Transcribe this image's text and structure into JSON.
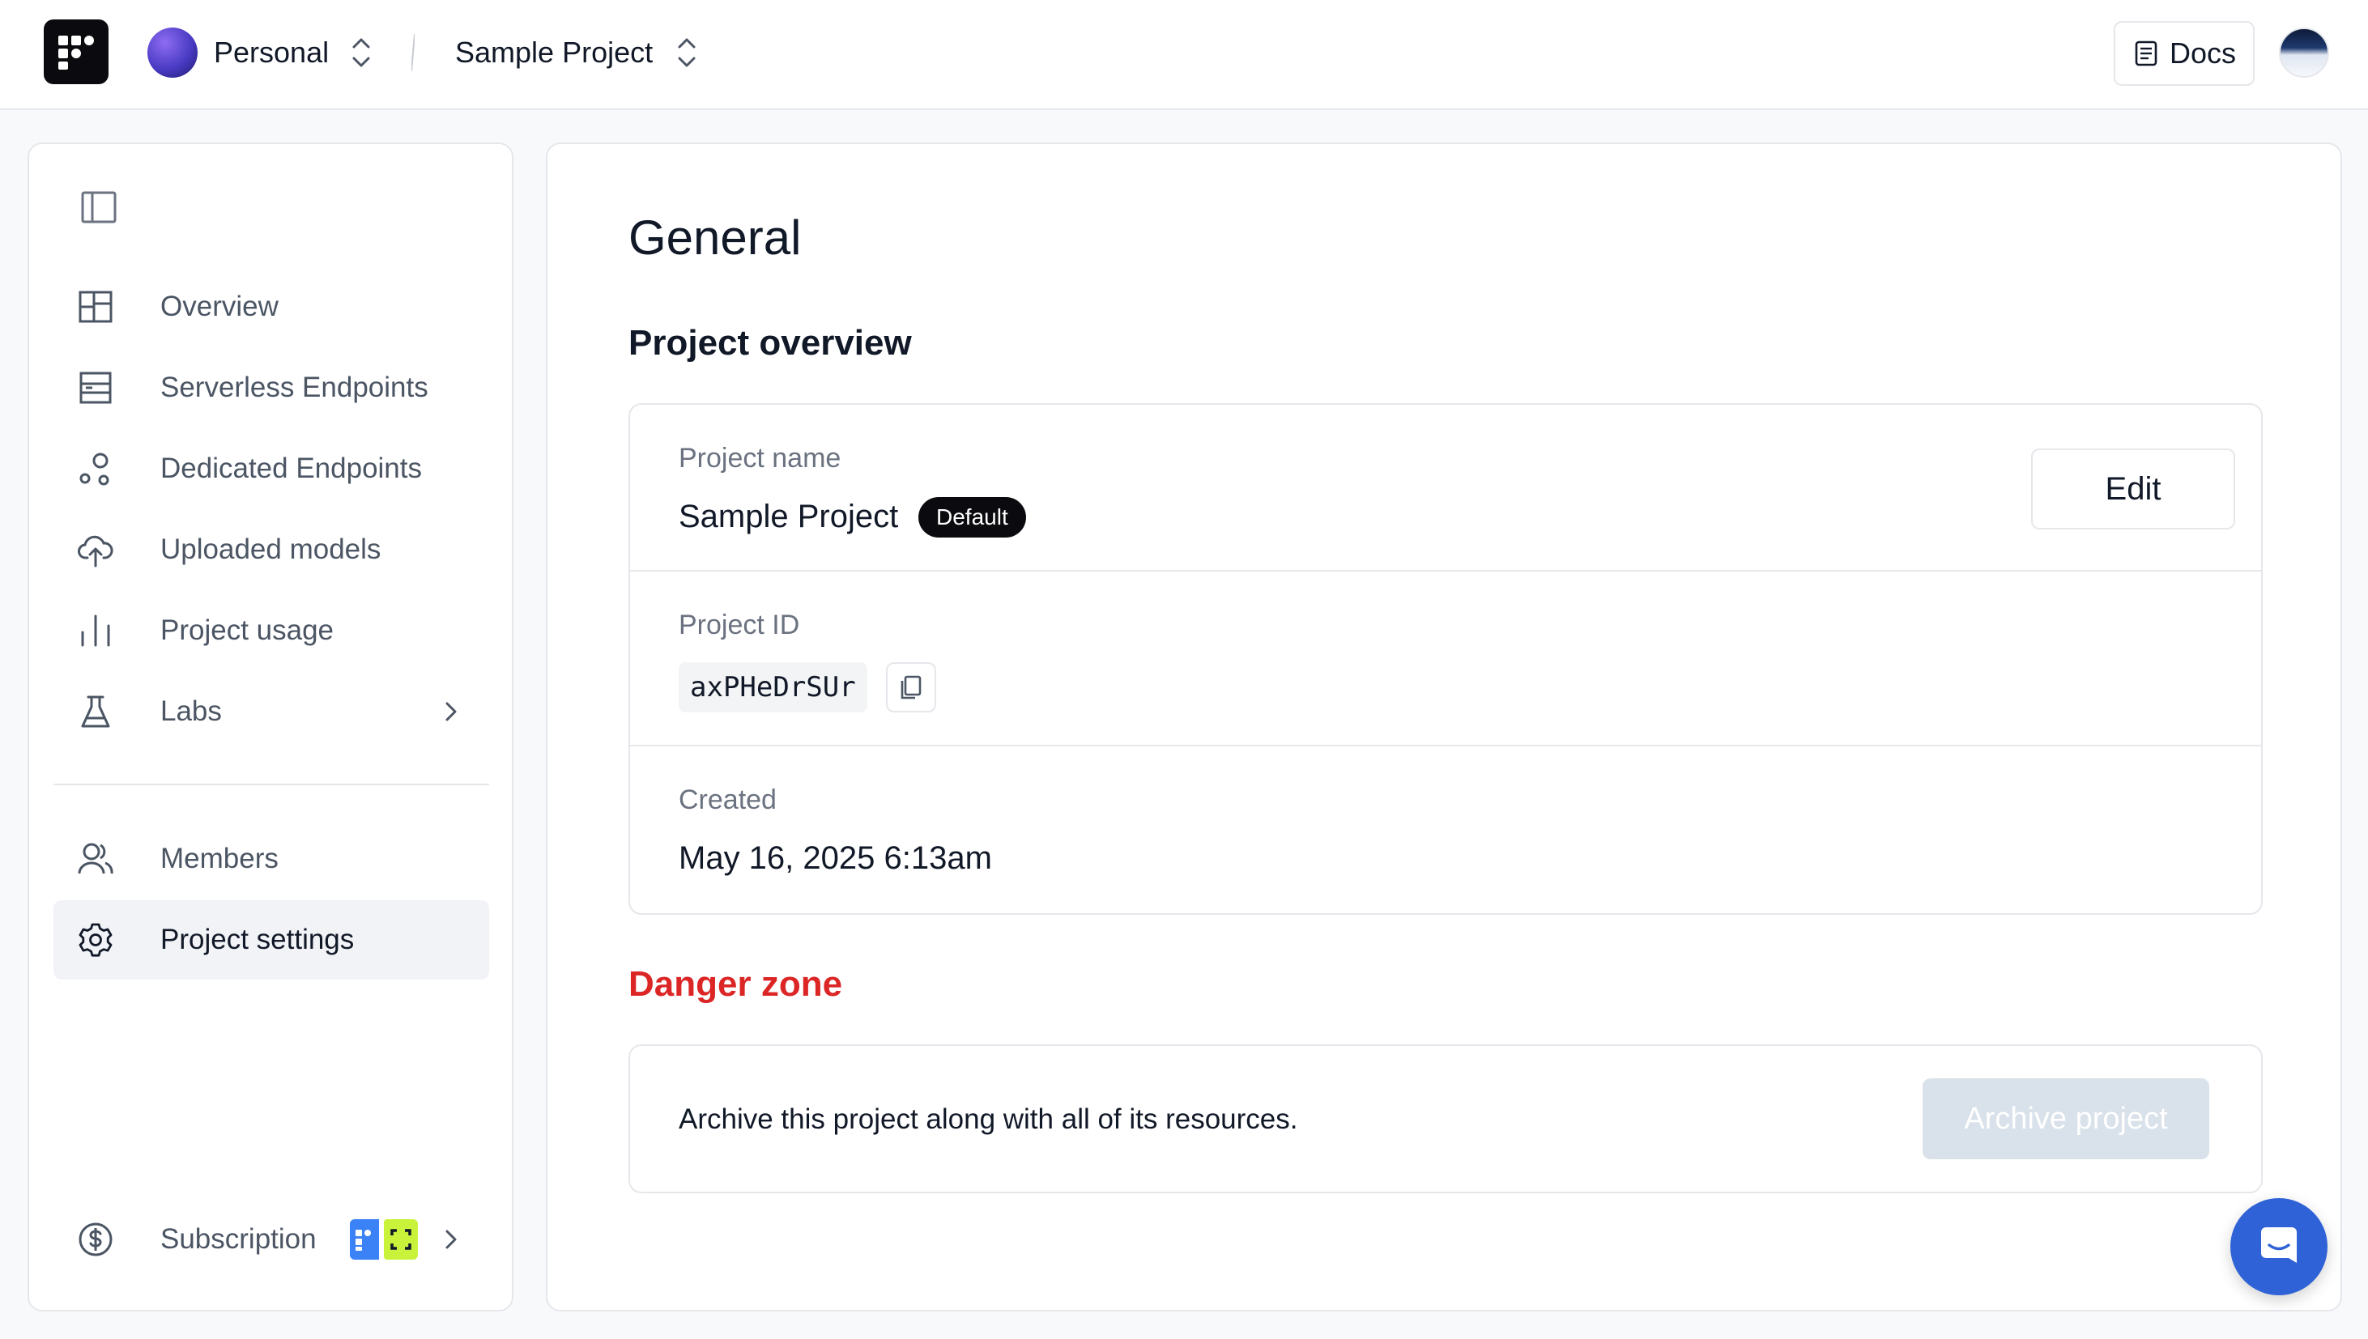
{
  "header": {
    "org_name": "Personal",
    "project_name": "Sample Project",
    "docs_label": "Docs",
    "icons": [
      "logo",
      "chevron-up-down-icon",
      "docs-icon",
      "user-avatar"
    ]
  },
  "sidebar": {
    "items": [
      {
        "label": "Overview",
        "icon": "layout-icon"
      },
      {
        "label": "Serverless Endpoints",
        "icon": "server-icon"
      },
      {
        "label": "Dedicated Endpoints",
        "icon": "nodes-icon"
      },
      {
        "label": "Uploaded models",
        "icon": "cloud-upload-icon"
      },
      {
        "label": "Project usage",
        "icon": "bar-chart-icon"
      },
      {
        "label": "Labs",
        "icon": "flask-icon"
      },
      {
        "label": "Members",
        "icon": "users-icon"
      },
      {
        "label": "Project settings",
        "icon": "gear-icon",
        "active": true
      }
    ],
    "subscription_label": "Subscription"
  },
  "main": {
    "title": "General",
    "overview_title": "Project overview",
    "project_name_label": "Project name",
    "project_name_value": "Sample Project",
    "default_badge": "Default",
    "edit_label": "Edit",
    "project_id_label": "Project ID",
    "project_id_value": "axPHeDrSUr",
    "created_label": "Created",
    "created_value": "May 16, 2025 6:13am",
    "danger_title": "Danger zone",
    "danger_text": "Archive this project along with all of its resources.",
    "archive_label": "Archive project"
  },
  "colors": {
    "danger": "#dc2626",
    "active_bg": "#f1f3f6",
    "chat": "#2f62d6",
    "archive_disabled": "#d9e1ea"
  }
}
